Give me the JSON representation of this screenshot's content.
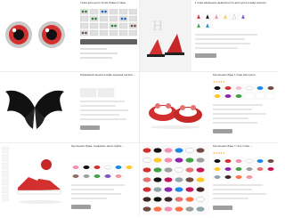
{
  "listings": [
    {
      "title": "Глаза для кукол 12 мм Новые 2 пары",
      "price": "",
      "meta": []
    },
    {
      "title": "1 пара маленьких дьявола рога для кукол в виде заколок",
      "price": "",
      "meta": []
    },
    {
      "title": "Украшения крылья в виде крыльев ангела ...",
      "price": "",
      "meta": []
    },
    {
      "title": "Кукольная обувь 1 пара для кукол",
      "price": "",
      "meta": []
    },
    {
      "title": "Кукольная обувь, сандалии, мини-туфли...",
      "price": "",
      "meta": []
    },
    {
      "title": "Кукольная обувь 7 см в стиле ...",
      "price": "",
      "meta": []
    }
  ],
  "ui": {
    "view_button": "Купить"
  },
  "colors": {
    "accent_red": "#e53935",
    "star": "#f9a825",
    "divider": "#eeeeee"
  }
}
